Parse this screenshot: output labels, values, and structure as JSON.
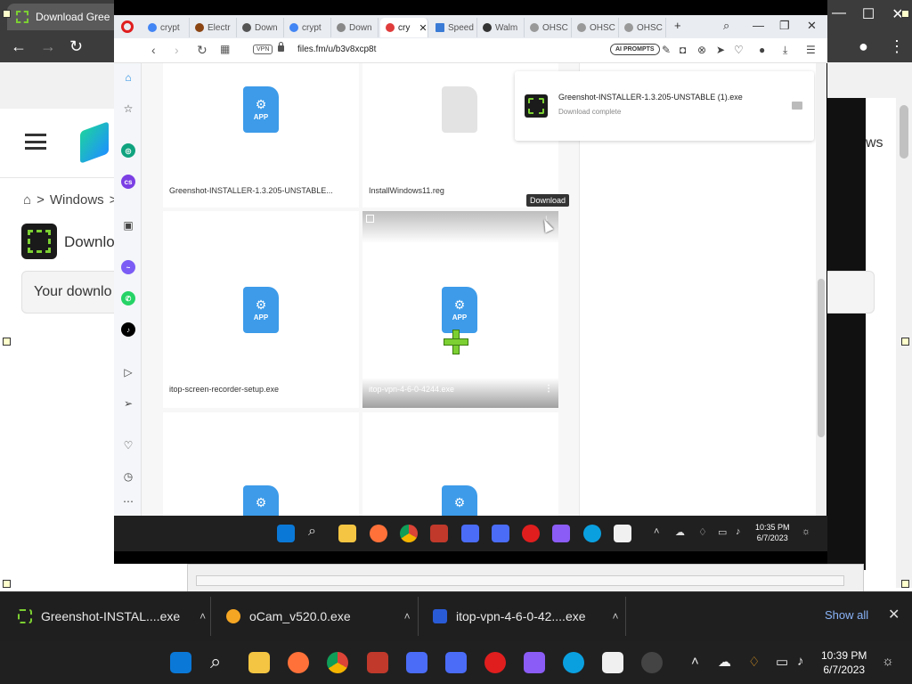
{
  "outer_browser": {
    "active_tab_title": "Download Gree",
    "window_controls": [
      "—",
      "☐",
      "✕"
    ]
  },
  "site": {
    "breadcrumb": [
      "Windows",
      ">"
    ],
    "app_title_partial": "Downlo",
    "download_box_text": "Your downlo",
    "right_partial": "ws"
  },
  "opera": {
    "tabs": [
      {
        "label": "crypt",
        "color": "#4285f4"
      },
      {
        "label": "Electr",
        "color": "#8b4513"
      },
      {
        "label": "Down",
        "color": "#555555"
      },
      {
        "label": "crypt",
        "color": "#4285f4"
      },
      {
        "label": "Down",
        "color": "#888888"
      },
      {
        "label": "cry",
        "color": "#e03c3c",
        "active": true
      },
      {
        "label": "Speed",
        "color": "#3a7bd5"
      },
      {
        "label": "Walm",
        "color": "#333333"
      },
      {
        "label": "OHSC",
        "color": "#999999"
      },
      {
        "label": "OHSC",
        "color": "#999999"
      },
      {
        "label": "OHSC",
        "color": "#999999"
      }
    ],
    "address": {
      "vpn_label": "VPN",
      "url": "files.fm/u/b3v8xcp8t",
      "ai_prompts_label": "AI PROMPTS"
    }
  },
  "files": [
    {
      "name": "Greenshot-INSTALLER-1.3.205-UNSTABLE...",
      "type": "app",
      "icon_label": "APP"
    },
    {
      "name": "InstallWindows11.reg",
      "type": "generic"
    },
    {
      "name": "itop-screen-recorder-setup.exe",
      "type": "app",
      "icon_label": "APP"
    },
    {
      "name": "itop-vpn-4-6-0-4244.exe",
      "type": "app",
      "icon_label": "APP"
    },
    {
      "name": "",
      "type": "app"
    },
    {
      "name": "",
      "type": "app"
    }
  ],
  "hover_tooltip": "Download",
  "download_popup": {
    "file_name": "Greenshot-INSTALLER-1.3.205-UNSTABLE (1).exe",
    "status": "Download complete"
  },
  "inner_taskbar": {
    "time": "10:35 PM",
    "date": "6/7/2023"
  },
  "download_bar": {
    "items": [
      {
        "label": "Greenshot-INSTAL....exe",
        "color": "#7cd032"
      },
      {
        "label": "oCam_v520.0.exe",
        "color": "#f5a623"
      },
      {
        "label": "itop-vpn-4-6-0-42....exe",
        "color": "#2a5bd7"
      }
    ],
    "show_all": "Show all"
  },
  "taskbar": {
    "time": "10:39 PM",
    "date": "6/7/2023"
  }
}
